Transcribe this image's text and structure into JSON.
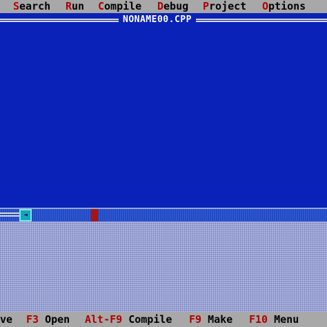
{
  "menubar": {
    "items": [
      {
        "hot": "S",
        "rest": "earch"
      },
      {
        "hot": "R",
        "rest": "un"
      },
      {
        "hot": "C",
        "rest": "ompile"
      },
      {
        "hot": "D",
        "rest": "ebug"
      },
      {
        "hot": "P",
        "rest": "roject"
      },
      {
        "hot": "O",
        "rest": "ptions"
      }
    ]
  },
  "editor": {
    "title": "NONAME00.CPP",
    "scroll_left_icon": "left-arrow-icon",
    "scroll_left_glyph": "◄"
  },
  "statusbar": {
    "partial": "ve",
    "items": [
      {
        "key": "F3",
        "desc": "Open"
      },
      {
        "key": "Alt-F9",
        "desc": "Compile"
      },
      {
        "key": "F9",
        "desc": "Make"
      },
      {
        "key": "F10",
        "desc": "Menu"
      }
    ]
  },
  "colors": {
    "editor_bg": "#0a22b8",
    "menu_bg": "#a8a8a8",
    "hotkey": "#b00000",
    "desktop": "#9aa3d4"
  }
}
